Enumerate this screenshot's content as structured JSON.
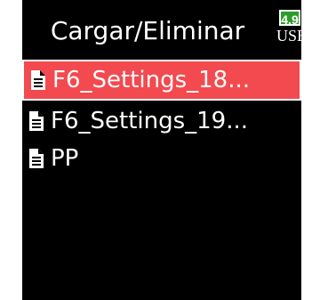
{
  "header": {
    "title": "Cargar/Eliminar",
    "battery_level": "4.9",
    "connection": "USB"
  },
  "files": {
    "items": [
      {
        "label": "F6_Settings_18...",
        "selected": true
      },
      {
        "label": "F6_Settings_19...",
        "selected": false
      },
      {
        "label": "PP",
        "selected": false
      }
    ]
  },
  "colors": {
    "background": "#000000",
    "selection": "#f24a4f",
    "battery": "#2f9b2c",
    "text": "#ffffff"
  },
  "icons": {
    "file": "document-icon"
  }
}
